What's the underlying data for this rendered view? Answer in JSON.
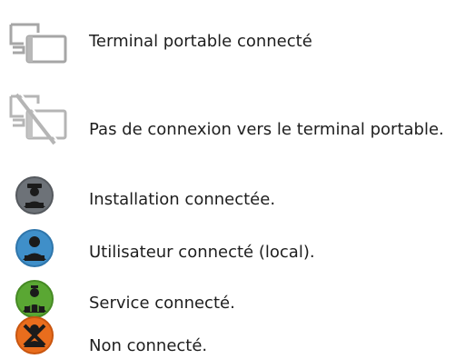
{
  "legend": {
    "items": [
      {
        "icon": "terminal-connected-icon",
        "label": "Terminal portable connecté"
      },
      {
        "icon": "terminal-disconnected-icon",
        "label": "Pas de connexion vers le terminal portable."
      },
      {
        "icon": "installation-connected-icon",
        "label": "Installation connectée.",
        "color": "#6d7278"
      },
      {
        "icon": "user-connected-icon",
        "label": "Utilisateur connecté (local).",
        "color": "#3f8fc9"
      },
      {
        "icon": "service-connected-icon",
        "label": "Service connecté.",
        "color": "#5aa733"
      },
      {
        "icon": "not-connected-icon",
        "label": "Non connecté.",
        "color": "#e96d1d"
      }
    ]
  }
}
